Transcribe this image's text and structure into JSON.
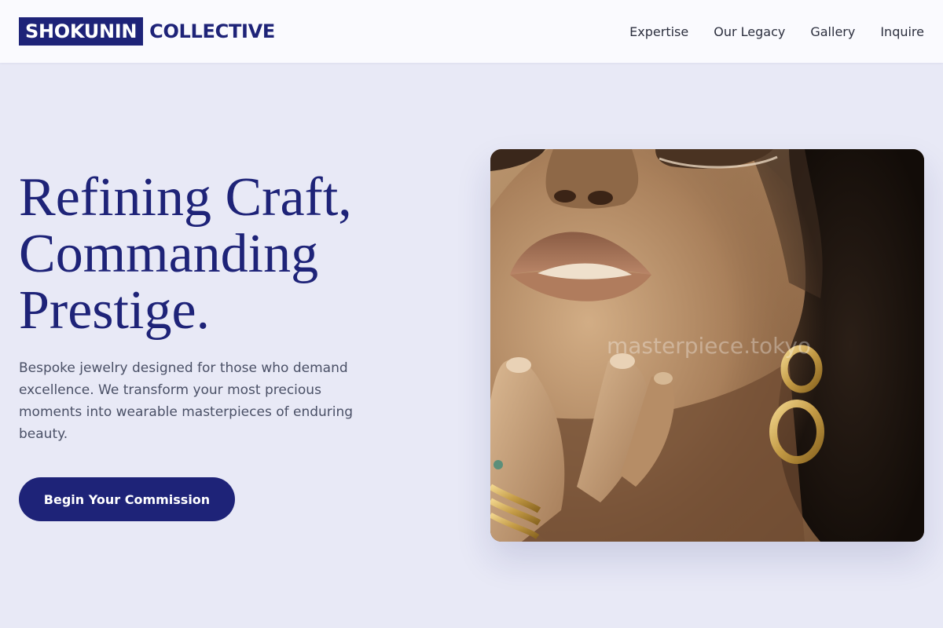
{
  "brand": {
    "logo_box_text": "SHOKUNIN",
    "logo_text": "COLLECTIVE",
    "primary_color": "#1e2378"
  },
  "nav": {
    "items": [
      {
        "label": "Expertise"
      },
      {
        "label": "Our Legacy"
      },
      {
        "label": "Gallery"
      },
      {
        "label": "Inquire"
      }
    ]
  },
  "hero": {
    "title_lines": [
      "Refining Craft,",
      "Commanding",
      "Prestige."
    ],
    "description": "Bespoke jewelry designed for those who demand excellence. We transform your most precious moments into wearable masterpieces of enduring beauty.",
    "cta_label": "Begin Your Commission",
    "image": {
      "watermark": "masterpiece.tokyo"
    }
  }
}
